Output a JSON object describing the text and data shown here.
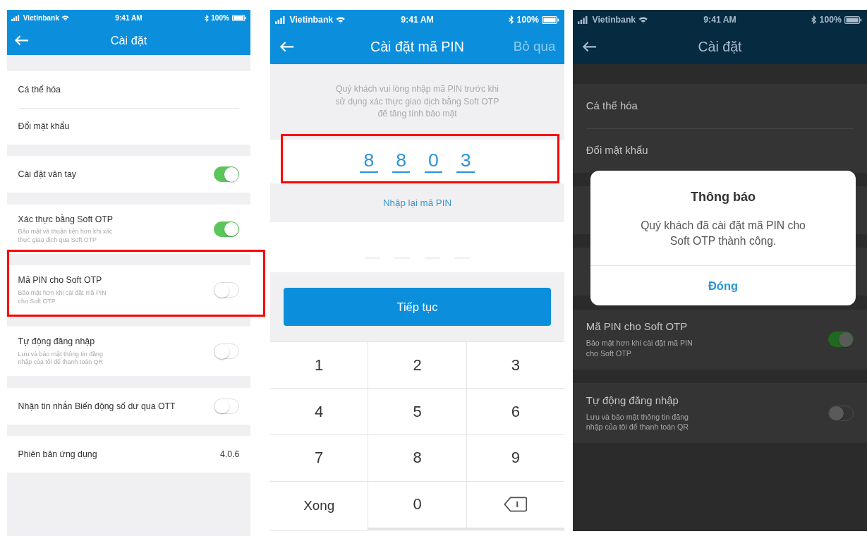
{
  "screens": [
    {
      "kind": "settings",
      "status_bar": {
        "carrier": "Vietinbank",
        "time": "9:41 AM",
        "battery": "100%"
      },
      "header": {
        "title": "Cài đặt"
      },
      "groups": [
        {
          "rows": [
            {
              "kind": "link",
              "title": "Cá thể hóa"
            },
            {
              "kind": "link",
              "title": "Đổi mật khẩu"
            }
          ]
        },
        {
          "rows": [
            {
              "kind": "toggle",
              "title": "Cài đặt vân tay",
              "on": true
            }
          ]
        },
        {
          "rows": [
            {
              "kind": "toggle",
              "title": "Xác thực bằng Soft OTP",
              "subtitle": "Bảo mật và thuận tiện hơn khi xác thực giao dịch qua Soft OTP",
              "on": true
            }
          ]
        },
        {
          "rows": [
            {
              "kind": "toggle",
              "title": "Mã PIN cho Soft OTP",
              "subtitle": "Bảo mật hơn khi cài đặt mã PIN cho Soft OTP",
              "on": false,
              "highlighted": true
            }
          ]
        },
        {
          "rows": [
            {
              "kind": "toggle",
              "title": "Tự động đăng nhập",
              "subtitle": "Lưu và bảo mật thông tin đăng nhập của tôi để thanh toán QR",
              "on": false
            }
          ]
        },
        {
          "rows": [
            {
              "kind": "toggle",
              "title": "Nhận tin nhắn Biến động số dư qua OTT",
              "on": false
            }
          ]
        },
        {
          "rows": [
            {
              "kind": "value",
              "title": "Phiên bản ứng dụng",
              "value": "4.0.6"
            }
          ]
        }
      ]
    },
    {
      "kind": "pin_setup",
      "status_bar": {
        "carrier": "Vietinbank",
        "time": "9:41 AM",
        "battery": "100%"
      },
      "header": {
        "title": "Cài đặt mã PIN",
        "action": "Bỏ qua"
      },
      "instruction": "Quý khách vui lòng nhập mã PIN trước khi sử dụng xác thực giao dịch bằng Soft OTP để tăng tính bảo mật",
      "pin_entry": {
        "digits": [
          "8",
          "8",
          "0",
          "3"
        ],
        "highlighted": true
      },
      "confirm_label": "Nhập lại mã PIN",
      "continue_button": "Tiếp tục",
      "keypad": [
        "1",
        "2",
        "3",
        "4",
        "5",
        "6",
        "7",
        "8",
        "9",
        "Xong",
        "0"
      ]
    },
    {
      "kind": "settings",
      "status_bar": {
        "carrier": "Vietinbank",
        "time": "9:41 AM",
        "battery": "100%"
      },
      "header": {
        "title": "Cài đặt"
      },
      "groups": [
        {
          "rows": [
            {
              "kind": "link",
              "title": "Cá thể hóa"
            },
            {
              "kind": "link",
              "title": "Đổi mật khẩu"
            }
          ]
        },
        {
          "rows": [
            {
              "kind": "covered"
            }
          ]
        },
        {
          "rows": [
            {
              "kind": "covered"
            }
          ]
        },
        {
          "rows": [
            {
              "kind": "toggle",
              "title": "Mã PIN cho Soft OTP",
              "subtitle": "Bảo mật hơn khi cài đặt mã PIN cho Soft OTP",
              "on": true
            }
          ]
        },
        {
          "rows": [
            {
              "kind": "toggle",
              "title": "Tự động đăng nhập",
              "subtitle": "Lưu và bảo mật thông tin đăng nhập của tôi để thanh toán QR",
              "on": false
            }
          ]
        }
      ],
      "dialog": {
        "title": "Thông báo",
        "message": "Quý khách đã cài đặt mã PIN cho Soft OTP thành công.",
        "button": "Đóng"
      }
    }
  ]
}
